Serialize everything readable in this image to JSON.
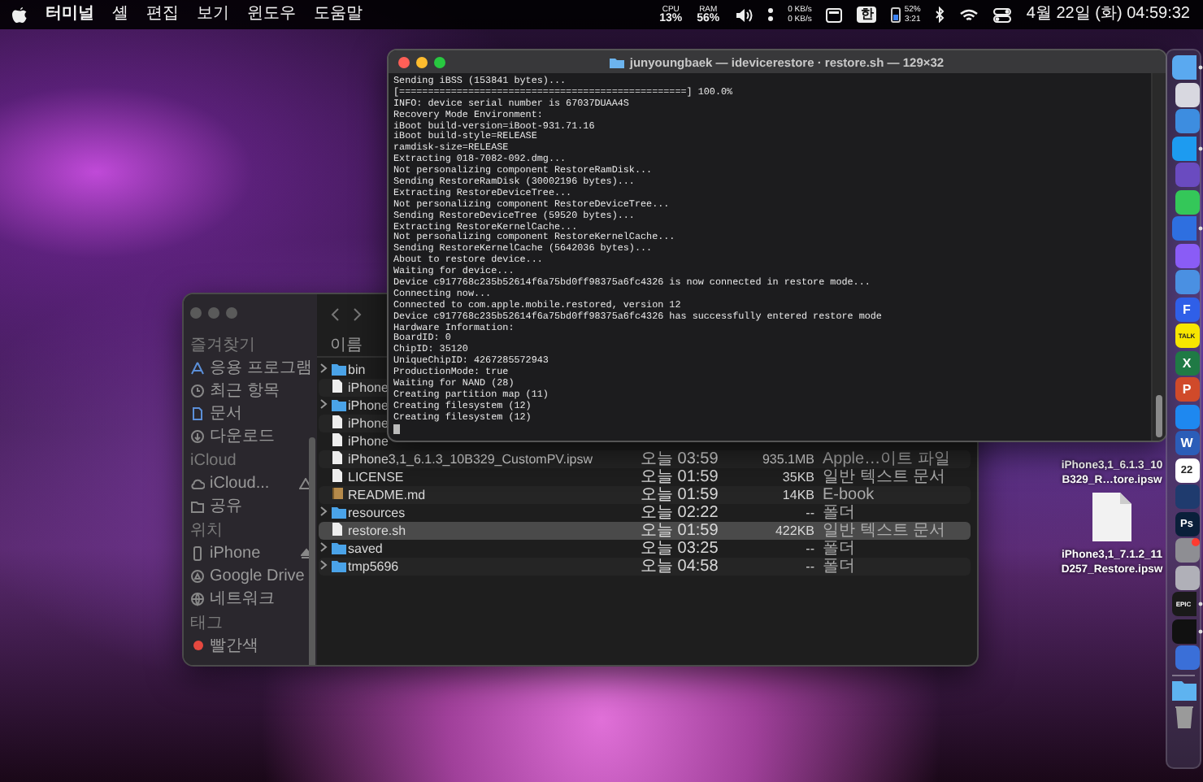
{
  "menu_bar": {
    "app_menu": "터미널",
    "menus": [
      "셸",
      "편집",
      "보기",
      "윈도우",
      "도움말"
    ],
    "status": {
      "cpu_label": "CPU",
      "cpu_value": "13%",
      "ram_label": "RAM",
      "ram_value": "56%",
      "net_up": "0 KB/s",
      "net_down": "0 KB/s",
      "input_source": "한",
      "battery_percent": "52%",
      "battery_time": "3:21"
    },
    "clock": "4월 22일 (화) 04:59:32"
  },
  "terminal": {
    "title": "junyoungbaek — idevicerestore · restore.sh — 129×32",
    "lines": [
      "Sending iBSS (153841 bytes)...",
      "[==================================================] 100.0%",
      "INFO: device serial number is 67037DUAA4S",
      "Recovery Mode Environment:",
      "iBoot build-version=iBoot-931.71.16",
      "iBoot build-style=RELEASE",
      "ramdisk-size=RELEASE",
      "Extracting 018-7082-092.dmg...",
      "Not personalizing component RestoreRamDisk...",
      "Sending RestoreRamDisk (30002196 bytes)...",
      "Extracting RestoreDeviceTree...",
      "Not personalizing component RestoreDeviceTree...",
      "Sending RestoreDeviceTree (59520 bytes)...",
      "Extracting RestoreKernelCache...",
      "Not personalizing component RestoreKernelCache...",
      "Sending RestoreKernelCache (5642036 bytes)...",
      "About to restore device...",
      "Waiting for device...",
      "Device c917768c235b52614f6a75bd0ff98375a6fc4326 is now connected in restore mode...",
      "Connecting now...",
      "Connected to com.apple.mobile.restored, version 12",
      "Device c917768c235b52614f6a75bd0ff98375a6fc4326 has successfully entered restore mode",
      "Hardware Information:",
      "BoardID: 0",
      "ChipID: 35120",
      "UniqueChipID: 4267285572943",
      "ProductionMode: true",
      "Waiting for NAND (28)",
      "Creating partition map (11)",
      "Creating filesystem (12)",
      "Creating filesystem (12)"
    ]
  },
  "finder": {
    "sidebar": [
      {
        "title": "즐겨찾기",
        "items": [
          {
            "label": "응용 프로그램",
            "kind": "apps"
          },
          {
            "label": "최근 항목",
            "kind": "recent"
          },
          {
            "label": "문서",
            "kind": "doc"
          },
          {
            "label": "다운로드",
            "kind": "download"
          }
        ]
      },
      {
        "title": "iCloud",
        "items": [
          {
            "label": "iCloud...",
            "kind": "cloud",
            "warning": true
          },
          {
            "label": "공유",
            "kind": "shared"
          }
        ]
      },
      {
        "title": "위치",
        "items": [
          {
            "label": "iPhone",
            "kind": "phone",
            "eject": true
          },
          {
            "label": "Google Drive",
            "kind": "drive"
          },
          {
            "label": "네트워크",
            "kind": "network"
          }
        ]
      },
      {
        "title": "태그",
        "items": [
          {
            "label": "빨간색",
            "kind": "tag",
            "color": "#e5483f"
          }
        ]
      }
    ],
    "column_header": "이름",
    "rows": [
      {
        "name": "bin",
        "kind": "folder",
        "expanded": false,
        "selected": false
      },
      {
        "name": "iPhone",
        "kind": "file",
        "selected": false
      },
      {
        "name": "iPhone",
        "kind": "folder",
        "expanded": false,
        "selected": false
      },
      {
        "name": "iPhone",
        "kind": "file",
        "selected": false
      },
      {
        "name": "iPhone",
        "kind": "file",
        "selected": false
      },
      {
        "name": "iPhone3,1_6.1.3_10B329_CustomPV.ipsw",
        "kind": "file",
        "date": "오늘 03:59",
        "size": "935.1MB",
        "file_type": "Apple…이트 파일",
        "selected": false
      },
      {
        "name": "LICENSE",
        "kind": "file",
        "date": "오늘 01:59",
        "size": "35KB",
        "file_type": "일반 텍스트 문서",
        "selected": false
      },
      {
        "name": "README.md",
        "kind": "book",
        "date": "오늘 01:59",
        "size": "14KB",
        "file_type": "E-book",
        "selected": false
      },
      {
        "name": "resources",
        "kind": "folder",
        "expanded": false,
        "date": "오늘 02:22",
        "size": "--",
        "file_type": "폴더",
        "selected": false
      },
      {
        "name": "restore.sh",
        "kind": "file",
        "date": "오늘 01:59",
        "size": "422KB",
        "file_type": "일반 텍스트 문서",
        "selected": true
      },
      {
        "name": "saved",
        "kind": "folder",
        "expanded": false,
        "date": "오늘 03:25",
        "size": "--",
        "file_type": "폴더",
        "selected": false
      },
      {
        "name": "tmp5696",
        "kind": "folder",
        "expanded": false,
        "date": "오늘 04:58",
        "size": "--",
        "file_type": "폴더",
        "selected": false
      }
    ]
  },
  "desktop_files": [
    {
      "label": "iPhone3,1_6.1.3_10B329_R…tore.ipsw",
      "icon_visible": false
    },
    {
      "label": "iPhone3,1_7.1.2_11D257_Restore.ipsw",
      "icon_visible": true
    }
  ],
  "dock": [
    {
      "kind": "app",
      "color": "#5aa9f0",
      "running": true,
      "badge": false
    },
    {
      "kind": "app",
      "color": "#d8d8e0",
      "running": false,
      "badge": false
    },
    {
      "kind": "app",
      "color": "#3d8de0",
      "running": false,
      "badge": false
    },
    {
      "kind": "app",
      "color": "#1d9bf0",
      "running": true,
      "badge": false
    },
    {
      "kind": "app",
      "color": "#6a4bc0",
      "running": false,
      "badge": false
    },
    {
      "kind": "app",
      "color": "#34c759",
      "running": false,
      "badge": false
    },
    {
      "kind": "app",
      "color": "#2e6fe0",
      "running": true,
      "badge": false
    },
    {
      "kind": "app",
      "color": "#8a5cf6",
      "running": false,
      "badge": false
    },
    {
      "kind": "app",
      "color": "#4a90e2",
      "running": false,
      "badge": false
    },
    {
      "kind": "app",
      "color": "#2f5fe8",
      "glyph": "F",
      "running": false,
      "badge": false
    },
    {
      "kind": "app",
      "color": "#f7e600",
      "glyph": "TALK",
      "running": false,
      "badge": false
    },
    {
      "kind": "app",
      "color": "#1f7a45",
      "glyph": "X",
      "running": false,
      "badge": false
    },
    {
      "kind": "app",
      "color": "#d04a2a",
      "glyph": "P",
      "running": false,
      "badge": false
    },
    {
      "kind": "app",
      "color": "#1e88f0",
      "running": false,
      "badge": false
    },
    {
      "kind": "app",
      "color": "#2b5db8",
      "glyph": "W",
      "running": false,
      "badge": false
    },
    {
      "kind": "app",
      "color": "#ffffff",
      "glyph": "22",
      "running": false,
      "badge": false
    },
    {
      "kind": "app",
      "color": "#1f3b6e",
      "running": false,
      "badge": false
    },
    {
      "kind": "app",
      "color": "#0a1f3a",
      "glyph": "Ps",
      "running": false,
      "badge": false
    },
    {
      "kind": "app",
      "color": "#8e8e93",
      "running": false,
      "badge": true
    },
    {
      "kind": "app",
      "color": "#b0b0b8",
      "running": false,
      "badge": false
    },
    {
      "kind": "app",
      "color": "#1a1a1a",
      "glyph": "EPIC",
      "running": true,
      "badge": false
    },
    {
      "kind": "app",
      "color": "#111111",
      "running": true,
      "badge": false
    },
    {
      "kind": "app",
      "color": "#3a6fd8",
      "running": false,
      "badge": false
    },
    {
      "kind": "divider"
    },
    {
      "kind": "folder",
      "color": "#5eb3f0"
    },
    {
      "kind": "trash",
      "color": "#9a9a9a"
    }
  ]
}
